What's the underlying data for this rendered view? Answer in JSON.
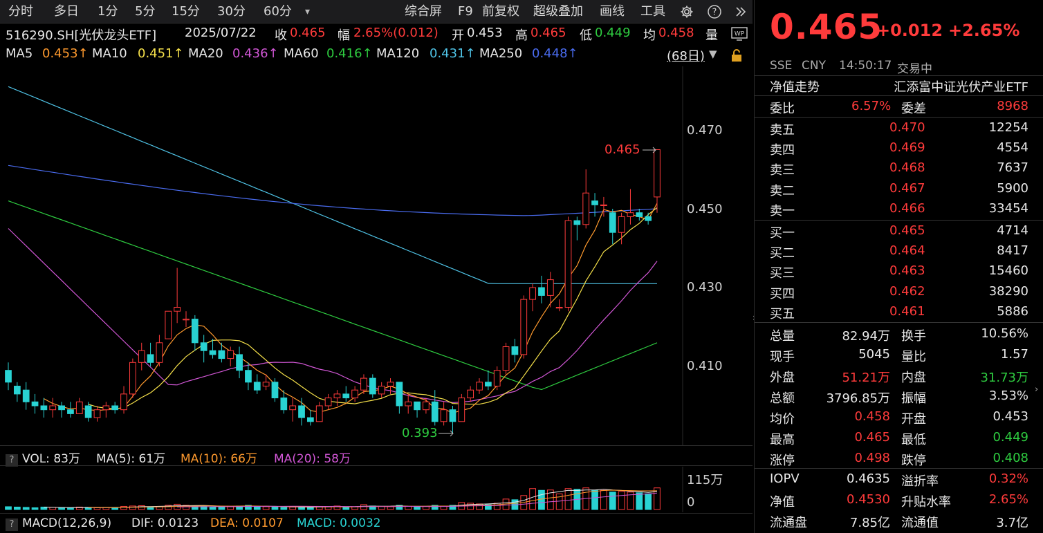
{
  "toolbar": {
    "left_items": [
      "分时",
      "多日",
      "1分",
      "5分",
      "15分",
      "30分",
      "60分"
    ],
    "dropdown_glyph": "▾",
    "right_items": [
      "综合屏",
      "F9",
      "前复权",
      "超级叠加",
      "画线",
      "工具"
    ],
    "settings_icon": "gear-icon",
    "help_icon": "help-icon",
    "more_icon": "double-chevron-right-icon"
  },
  "quote_bar": {
    "code_name": "516290.SH[光伏龙头ETF]",
    "date": "2025/07/22",
    "close_label": "收",
    "close_value": "0.465",
    "range_label": "幅",
    "range_value": "2.65%(0.012)",
    "open_label": "开",
    "open_value": "0.453",
    "high_label": "高",
    "high_value": "0.465",
    "low_label": "低",
    "low_value": "0.449",
    "avg_label": "均",
    "avg_value": "0.458",
    "vol_label": "量"
  },
  "ma_bar": {
    "items": [
      {
        "label": "MA5",
        "value": "0.453↑",
        "color": "#ff9a2e"
      },
      {
        "label": "MA10",
        "value": "0.451↑",
        "color": "#f5e04a"
      },
      {
        "label": "MA20",
        "value": "0.436↑",
        "color": "#d257d6"
      },
      {
        "label": "MA60",
        "value": "0.416↑",
        "color": "#2ecc40"
      },
      {
        "label": "MA120",
        "value": "0.431↑",
        "color": "#4fc3e6"
      },
      {
        "label": "MA250",
        "value": "0.448↑",
        "color": "#4a6cf0"
      }
    ],
    "period": "(68日)"
  },
  "price_axis": [
    "0.470",
    "0.450",
    "0.430",
    "0.410"
  ],
  "annotations": {
    "high": "0.465",
    "low": "0.393"
  },
  "vol_bar": {
    "label": "VOL: 83万",
    "ma5": "MA(5): 61万",
    "ma10": "MA(10): 66万",
    "ma20": "MA(20): 58万",
    "axis_top": "115万",
    "axis_zero": "0"
  },
  "macd_bar": {
    "label": "MACD(12,26,9)",
    "dif": "DIF: 0.0123",
    "dea": "DEA: 0.0107",
    "macd": "MACD: 0.0032"
  },
  "colors": {
    "up": "#ff3b3b",
    "down": "#29d3d3",
    "green": "#2ecc40"
  },
  "chart_data": {
    "type": "candlestick",
    "series": [
      {
        "name": "K",
        "ohlc": [
          [
            0.409,
            0.411,
            0.404,
            0.406
          ],
          [
            0.405,
            0.406,
            0.401,
            0.403
          ],
          [
            0.404,
            0.406,
            0.399,
            0.401
          ],
          [
            0.401,
            0.403,
            0.398,
            0.4
          ],
          [
            0.4,
            0.402,
            0.397,
            0.399
          ],
          [
            0.399,
            0.402,
            0.397,
            0.4
          ],
          [
            0.4,
            0.401,
            0.397,
            0.399
          ],
          [
            0.399,
            0.401,
            0.397,
            0.398
          ],
          [
            0.398,
            0.402,
            0.398,
            0.401
          ],
          [
            0.4,
            0.401,
            0.396,
            0.397
          ],
          [
            0.397,
            0.4,
            0.396,
            0.399
          ],
          [
            0.399,
            0.401,
            0.397,
            0.4
          ],
          [
            0.4,
            0.401,
            0.398,
            0.399
          ],
          [
            0.399,
            0.405,
            0.398,
            0.403
          ],
          [
            0.403,
            0.412,
            0.402,
            0.411
          ],
          [
            0.411,
            0.416,
            0.409,
            0.414
          ],
          [
            0.413,
            0.416,
            0.41,
            0.411
          ],
          [
            0.411,
            0.418,
            0.41,
            0.416
          ],
          [
            0.417,
            0.42,
            0.422,
            0.424
          ],
          [
            0.424,
            0.435,
            0.421,
            0.425
          ],
          [
            0.422,
            0.424,
            0.42,
            0.422
          ],
          [
            0.422,
            0.423,
            0.414,
            0.416
          ],
          [
            0.416,
            0.418,
            0.411,
            0.414
          ],
          [
            0.414,
            0.417,
            0.412,
            0.413
          ],
          [
            0.414,
            0.416,
            0.411,
            0.412
          ],
          [
            0.412,
            0.415,
            0.41,
            0.414
          ],
          [
            0.413,
            0.415,
            0.407,
            0.409
          ],
          [
            0.409,
            0.411,
            0.404,
            0.406
          ],
          [
            0.406,
            0.408,
            0.403,
            0.404
          ],
          [
            0.405,
            0.408,
            0.404,
            0.406
          ],
          [
            0.406,
            0.407,
            0.401,
            0.402
          ],
          [
            0.402,
            0.404,
            0.398,
            0.399
          ],
          [
            0.399,
            0.402,
            0.396,
            0.4
          ],
          [
            0.4,
            0.402,
            0.395,
            0.397
          ],
          [
            0.397,
            0.399,
            0.395,
            0.396
          ],
          [
            0.396,
            0.401,
            0.396,
            0.4
          ],
          [
            0.4,
            0.403,
            0.399,
            0.402
          ],
          [
            0.402,
            0.404,
            0.4,
            0.403
          ],
          [
            0.403,
            0.405,
            0.401,
            0.402
          ],
          [
            0.402,
            0.405,
            0.401,
            0.404
          ],
          [
            0.404,
            0.408,
            0.403,
            0.407
          ],
          [
            0.407,
            0.408,
            0.402,
            0.403
          ],
          [
            0.403,
            0.406,
            0.402,
            0.405
          ],
          [
            0.405,
            0.407,
            0.403,
            0.406
          ],
          [
            0.406,
            0.406,
            0.398,
            0.4
          ],
          [
            0.4,
            0.403,
            0.398,
            0.401
          ],
          [
            0.401,
            0.401,
            0.397,
            0.399
          ],
          [
            0.399,
            0.402,
            0.398,
            0.401
          ],
          [
            0.401,
            0.404,
            0.395,
            0.396
          ],
          [
            0.396,
            0.401,
            0.395,
            0.399
          ],
          [
            0.399,
            0.4,
            0.393,
            0.396
          ],
          [
            0.396,
            0.403,
            0.396,
            0.402
          ],
          [
            0.402,
            0.405,
            0.401,
            0.404
          ],
          [
            0.404,
            0.407,
            0.403,
            0.406
          ],
          [
            0.406,
            0.409,
            0.404,
            0.405
          ],
          [
            0.405,
            0.41,
            0.404,
            0.409
          ],
          [
            0.409,
            0.416,
            0.408,
            0.415
          ],
          [
            0.415,
            0.417,
            0.411,
            0.413
          ],
          [
            0.413,
            0.428,
            0.412,
            0.427
          ],
          [
            0.427,
            0.431,
            0.424,
            0.43
          ],
          [
            0.43,
            0.433,
            0.426,
            0.428
          ],
          [
            0.428,
            0.434,
            0.425,
            0.432
          ],
          [
            0.425,
            0.427,
            0.424,
            0.425
          ],
          [
            0.425,
            0.448,
            0.424,
            0.447
          ],
          [
            0.447,
            0.448,
            0.442,
            0.446
          ],
          [
            0.446,
            0.46,
            0.445,
            0.454
          ],
          [
            0.452,
            0.454,
            0.448,
            0.451
          ],
          [
            0.451,
            0.453,
            0.448,
            0.451
          ],
          [
            0.449,
            0.45,
            0.441,
            0.444
          ],
          [
            0.444,
            0.449,
            0.441,
            0.448
          ],
          [
            0.448,
            0.455,
            0.446,
            0.449
          ],
          [
            0.449,
            0.45,
            0.447,
            0.448
          ],
          [
            0.448,
            0.449,
            0.446,
            0.447
          ],
          [
            0.453,
            0.465,
            0.449,
            0.465
          ]
        ]
      },
      {
        "name": "VOL",
        "values": [
          8,
          7,
          6,
          5,
          7,
          6,
          5,
          4,
          7,
          6,
          5,
          6,
          5,
          9,
          10,
          11,
          8,
          8,
          12,
          15,
          12,
          10,
          9,
          8,
          7,
          8,
          10,
          12,
          9,
          8,
          7,
          6,
          7,
          8,
          6,
          9,
          8,
          10,
          7,
          8,
          14,
          10,
          9,
          8,
          12,
          9,
          8,
          9,
          12,
          9,
          12,
          20,
          18,
          16,
          14,
          18,
          30,
          28,
          40,
          60,
          55,
          56,
          45,
          60,
          58,
          62,
          55,
          55,
          50,
          52,
          50,
          48,
          45,
          62
        ]
      }
    ]
  },
  "quote_header": {
    "price": "0.465",
    "change": "+0.012",
    "change_pct": "+2.65%",
    "exchange": "SSE",
    "currency": "CNY",
    "time": "14:50:17",
    "status": "交易中"
  },
  "nav_row": {
    "label": "净值走势",
    "fund_name": "汇添富中证光伏产业ETF"
  },
  "weibi": {
    "label1": "委比",
    "value1": "6.57%",
    "label2": "委差",
    "value2": "8968"
  },
  "sell_orders": [
    {
      "label": "卖五",
      "price": "0.470",
      "volume": "12254"
    },
    {
      "label": "卖四",
      "price": "0.469",
      "volume": "4554"
    },
    {
      "label": "卖三",
      "price": "0.468",
      "volume": "7637"
    },
    {
      "label": "卖二",
      "price": "0.467",
      "volume": "5900"
    },
    {
      "label": "卖一",
      "price": "0.466",
      "volume": "33454"
    }
  ],
  "buy_orders": [
    {
      "label": "买一",
      "price": "0.465",
      "volume": "4714"
    },
    {
      "label": "买二",
      "price": "0.464",
      "volume": "8417"
    },
    {
      "label": "买三",
      "price": "0.463",
      "volume": "15460"
    },
    {
      "label": "买四",
      "price": "0.462",
      "volume": "38290"
    },
    {
      "label": "买五",
      "price": "0.461",
      "volume": "5886"
    }
  ],
  "stats": [
    {
      "l1": "总量",
      "v1": "82.94万",
      "c1": "white",
      "l2": "换手",
      "v2": "10.56%",
      "c2": "white"
    },
    {
      "l1": "现手",
      "v1": "5045",
      "c1": "white",
      "l2": "量比",
      "v2": "1.57",
      "c2": "white"
    },
    {
      "l1": "外盘",
      "v1": "51.21万",
      "c1": "red",
      "l2": "内盘",
      "v2": "31.73万",
      "c2": "green"
    },
    {
      "l1": "总额",
      "v1": "3796.85万",
      "c1": "white",
      "l2": "振幅",
      "v2": "3.53%",
      "c2": "white"
    },
    {
      "l1": "均价",
      "v1": "0.458",
      "c1": "red",
      "l2": "开盘",
      "v2": "0.453",
      "c2": "white"
    },
    {
      "l1": "最高",
      "v1": "0.465",
      "c1": "red",
      "l2": "最低",
      "v2": "0.449",
      "c2": "green"
    },
    {
      "l1": "涨停",
      "v1": "0.498",
      "c1": "red",
      "l2": "跌停",
      "v2": "0.408",
      "c2": "green"
    }
  ],
  "iopv": [
    {
      "l1": "IOPV",
      "v1": "0.4635",
      "c1": "white",
      "l2": "溢折率",
      "v2": "0.32%",
      "c2": "red"
    },
    {
      "l1": "净值",
      "v1": "0.4530",
      "c1": "red",
      "l2": "升贴水率",
      "v2": "2.65%",
      "c2": "red"
    },
    {
      "l1": "流通盘",
      "v1": "7.85亿",
      "c1": "white",
      "l2": "流通值",
      "v2": "3.7亿",
      "c2": "white"
    }
  ]
}
